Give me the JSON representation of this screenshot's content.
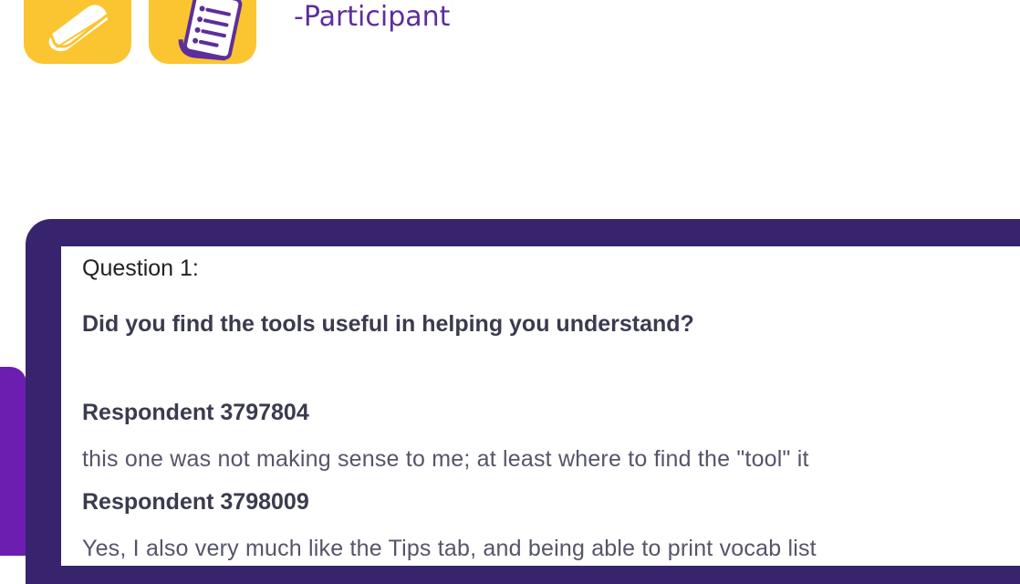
{
  "header": {
    "participant_label": "-Participant"
  },
  "icons": {
    "book": "book-icon",
    "list": "list-document-icon",
    "tile_color": "#fbc531",
    "accent_color": "#5d2e9c"
  },
  "panel": {
    "background_color": "#38246e"
  },
  "question": {
    "number_label": "Question 1:",
    "text": "Did you find the tools useful in helping you understand?"
  },
  "responses": [
    {
      "respondent": "Respondent 3797804",
      "text": "this one was not making sense to me; at least where to find the \"tool\" it"
    },
    {
      "respondent": "Respondent 3798009",
      "text": "Yes, I also very much like the Tips tab, and being able to print vocab list"
    }
  ]
}
